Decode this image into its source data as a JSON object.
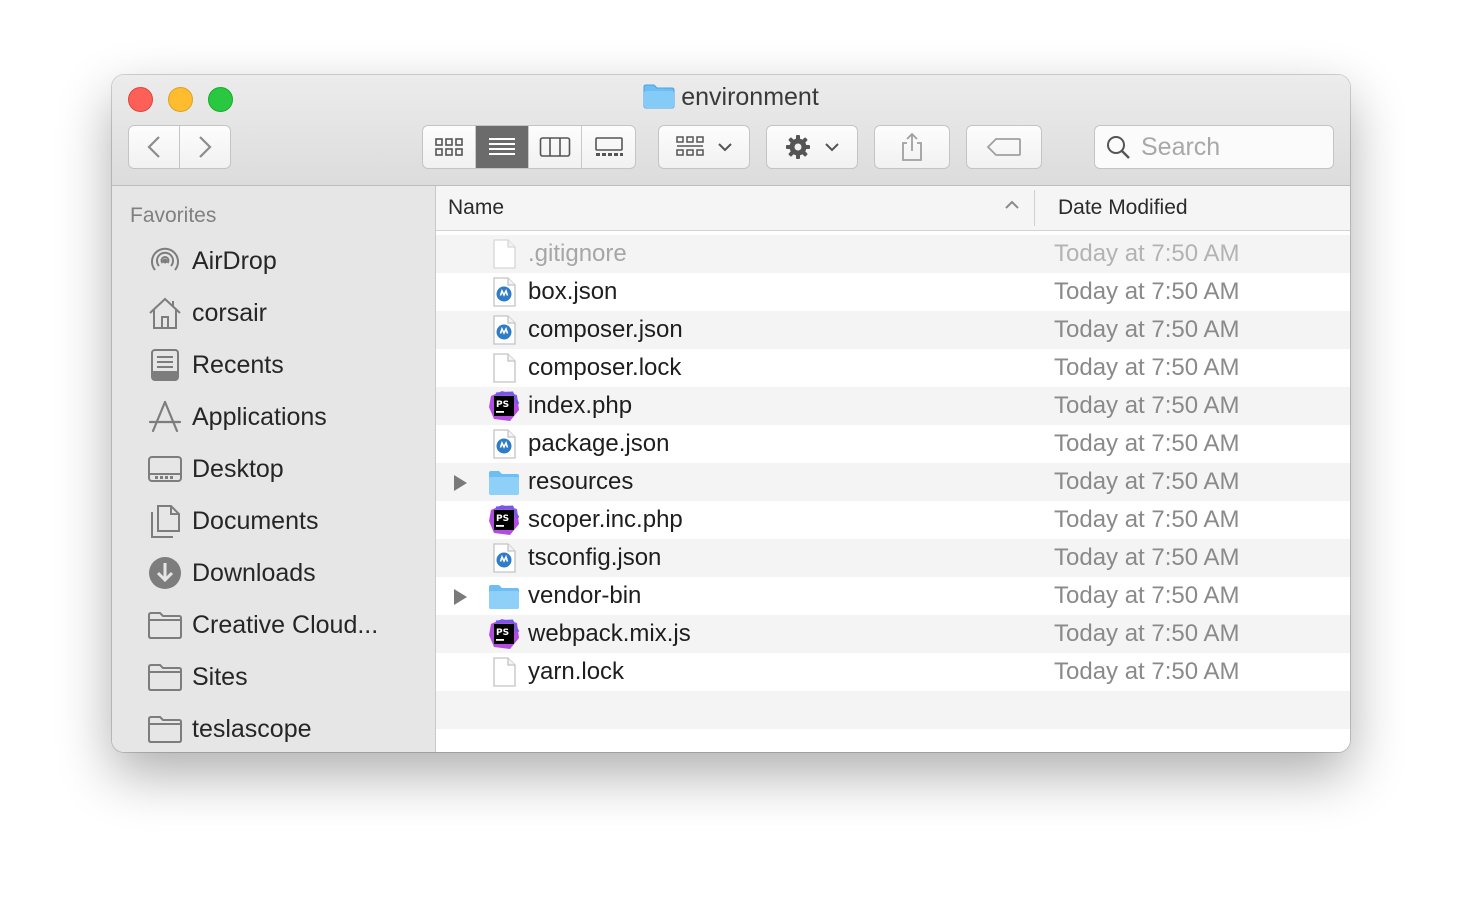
{
  "window": {
    "title": "environment",
    "folder_icon": "folder-icon"
  },
  "toolbar": {
    "back": "chevron-left-icon",
    "forward": "chevron-right-icon",
    "views": [
      "icon-view-icon",
      "list-view-icon",
      "column-view-icon",
      "gallery-view-icon"
    ],
    "active_view": "list-view-icon",
    "group": "group-icon",
    "action": "gear-icon",
    "share": "share-icon",
    "tag": "tag-icon",
    "search_placeholder": "Search"
  },
  "sidebar": {
    "heading": "Favorites",
    "items": [
      {
        "label": "AirDrop",
        "icon": "airdrop-icon"
      },
      {
        "label": "corsair",
        "icon": "home-icon"
      },
      {
        "label": "Recents",
        "icon": "recents-icon"
      },
      {
        "label": "Applications",
        "icon": "applications-icon"
      },
      {
        "label": "Desktop",
        "icon": "desktop-icon"
      },
      {
        "label": "Documents",
        "icon": "documents-icon"
      },
      {
        "label": "Downloads",
        "icon": "downloads-icon"
      },
      {
        "label": "Creative Cloud...",
        "icon": "folder-icon"
      },
      {
        "label": "Sites",
        "icon": "folder-icon"
      },
      {
        "label": "teslascope",
        "icon": "folder-icon"
      }
    ]
  },
  "columns": {
    "name": "Name",
    "date": "Date Modified"
  },
  "files": [
    {
      "name": ".gitignore",
      "date": "Today at 7:50 AM",
      "type": "generic-file-icon"
    },
    {
      "name": "box.json",
      "date": "Today at 7:50 AM",
      "type": "json-file-icon"
    },
    {
      "name": "composer.json",
      "date": "Today at 7:50 AM",
      "type": "json-file-icon"
    },
    {
      "name": "composer.lock",
      "date": "Today at 7:50 AM",
      "type": "generic-file-icon"
    },
    {
      "name": "index.php",
      "date": "Today at 7:50 AM",
      "type": "phpstorm-file-icon"
    },
    {
      "name": "package.json",
      "date": "Today at 7:50 AM",
      "type": "json-file-icon"
    },
    {
      "name": "resources",
      "date": "Today at 7:50 AM",
      "type": "folder-icon"
    },
    {
      "name": "scoper.inc.php",
      "date": "Today at 7:50 AM",
      "type": "phpstorm-file-icon"
    },
    {
      "name": "tsconfig.json",
      "date": "Today at 7:50 AM",
      "type": "json-file-icon"
    },
    {
      "name": "vendor-bin",
      "date": "Today at 7:50 AM",
      "type": "folder-icon"
    },
    {
      "name": "webpack.mix.js",
      "date": "Today at 7:50 AM",
      "type": "phpstorm-file-icon"
    },
    {
      "name": "yarn.lock",
      "date": "Today at 7:50 AM",
      "type": "generic-file-icon"
    }
  ],
  "colors": {
    "folder": "#6cbef5",
    "phpstorm": "#b44ce0",
    "accent": "#3b7fd1"
  }
}
